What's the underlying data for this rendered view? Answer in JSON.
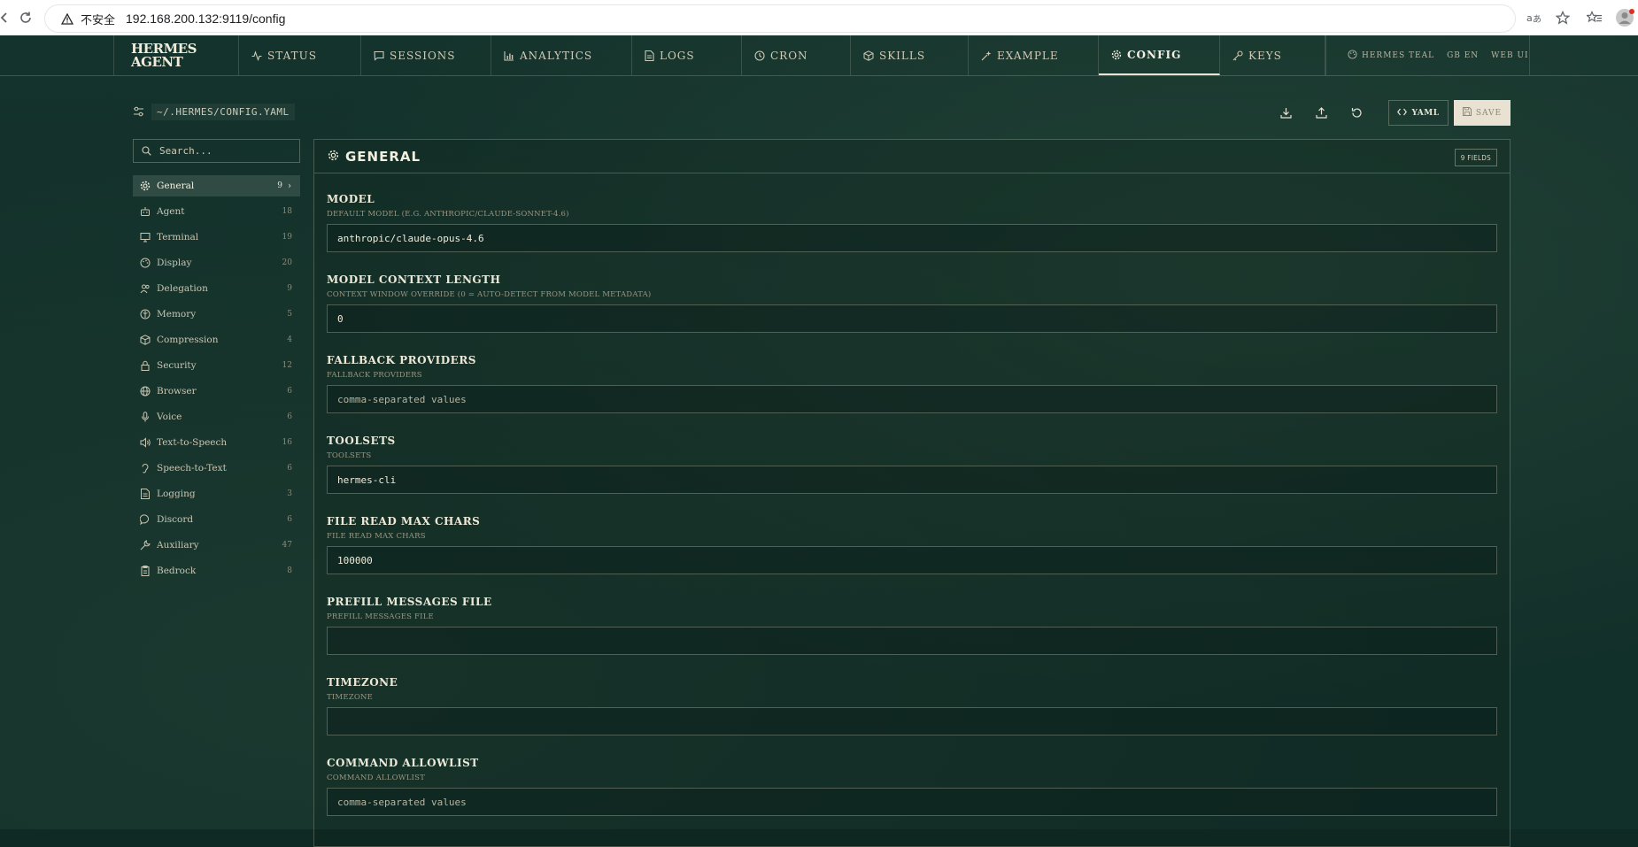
{
  "browser": {
    "insecure_label": "不安全",
    "url": "192.168.200.132:9119/config"
  },
  "brand": {
    "line1": "HERMES",
    "line2": "AGENT"
  },
  "nav": {
    "tabs": [
      {
        "label": "STATUS",
        "icon": "activity-icon"
      },
      {
        "label": "SESSIONS",
        "icon": "chat-icon"
      },
      {
        "label": "ANALYTICS",
        "icon": "bar-chart-icon"
      },
      {
        "label": "LOGS",
        "icon": "file-icon"
      },
      {
        "label": "CRON",
        "icon": "clock-icon"
      },
      {
        "label": "SKILLS",
        "icon": "cube-icon"
      },
      {
        "label": "EXAMPLE",
        "icon": "sparkle-icon"
      },
      {
        "label": "CONFIG",
        "icon": "gear-icon"
      },
      {
        "label": "KEYS",
        "icon": "key-icon"
      }
    ],
    "active": "CONFIG",
    "theme_label": "HERMES TEAL",
    "lang_label": "GB EN",
    "webui_label": "WEB UI"
  },
  "config": {
    "path": "~/.HERMES/CONFIG.YAML",
    "yaml_label": "YAML",
    "save_label": "SAVE"
  },
  "sidebar": {
    "search_placeholder": "Search...",
    "items": [
      {
        "label": "General",
        "count": "9",
        "icon": "gear-icon"
      },
      {
        "label": "Agent",
        "count": "18",
        "icon": "bot-icon"
      },
      {
        "label": "Terminal",
        "count": "19",
        "icon": "monitor-icon"
      },
      {
        "label": "Display",
        "count": "20",
        "icon": "palette-icon"
      },
      {
        "label": "Delegation",
        "count": "9",
        "icon": "users-icon"
      },
      {
        "label": "Memory",
        "count": "5",
        "icon": "brain-icon"
      },
      {
        "label": "Compression",
        "count": "4",
        "icon": "package-icon"
      },
      {
        "label": "Security",
        "count": "12",
        "icon": "lock-icon"
      },
      {
        "label": "Browser",
        "count": "6",
        "icon": "globe-icon"
      },
      {
        "label": "Voice",
        "count": "6",
        "icon": "mic-icon"
      },
      {
        "label": "Text-to-Speech",
        "count": "16",
        "icon": "speaker-icon"
      },
      {
        "label": "Speech-to-Text",
        "count": "6",
        "icon": "ear-icon"
      },
      {
        "label": "Logging",
        "count": "3",
        "icon": "file-text-icon"
      },
      {
        "label": "Discord",
        "count": "6",
        "icon": "message-icon"
      },
      {
        "label": "Auxiliary",
        "count": "47",
        "icon": "wrench-icon"
      },
      {
        "label": "Bedrock",
        "count": "8",
        "icon": "clipboard-icon"
      }
    ]
  },
  "panel": {
    "title": "GENERAL",
    "badge": "9 FIELDS",
    "fields": [
      {
        "title": "MODEL",
        "desc": "DEFAULT MODEL (E.G. ANTHROPIC/CLAUDE-SONNET-4.6)",
        "value": "anthropic/claude-opus-4.6",
        "placeholder": ""
      },
      {
        "title": "MODEL CONTEXT LENGTH",
        "desc": "CONTEXT WINDOW OVERRIDE (0 = AUTO-DETECT FROM MODEL METADATA)",
        "value": "0",
        "placeholder": ""
      },
      {
        "title": "FALLBACK PROVIDERS",
        "desc": "FALLBACK PROVIDERS",
        "value": "",
        "placeholder": "comma-separated values"
      },
      {
        "title": "TOOLSETS",
        "desc": "TOOLSETS",
        "value": "hermes-cli",
        "placeholder": ""
      },
      {
        "title": "FILE READ MAX CHARS",
        "desc": "FILE READ MAX CHARS",
        "value": "100000",
        "placeholder": ""
      },
      {
        "title": "PREFILL MESSAGES FILE",
        "desc": "PREFILL MESSAGES FILE",
        "value": "",
        "placeholder": ""
      },
      {
        "title": "TIMEZONE",
        "desc": "TIMEZONE",
        "value": "",
        "placeholder": ""
      },
      {
        "title": "COMMAND ALLOWLIST",
        "desc": "COMMAND ALLOWLIST",
        "value": "",
        "placeholder": "comma-separated values"
      }
    ]
  }
}
